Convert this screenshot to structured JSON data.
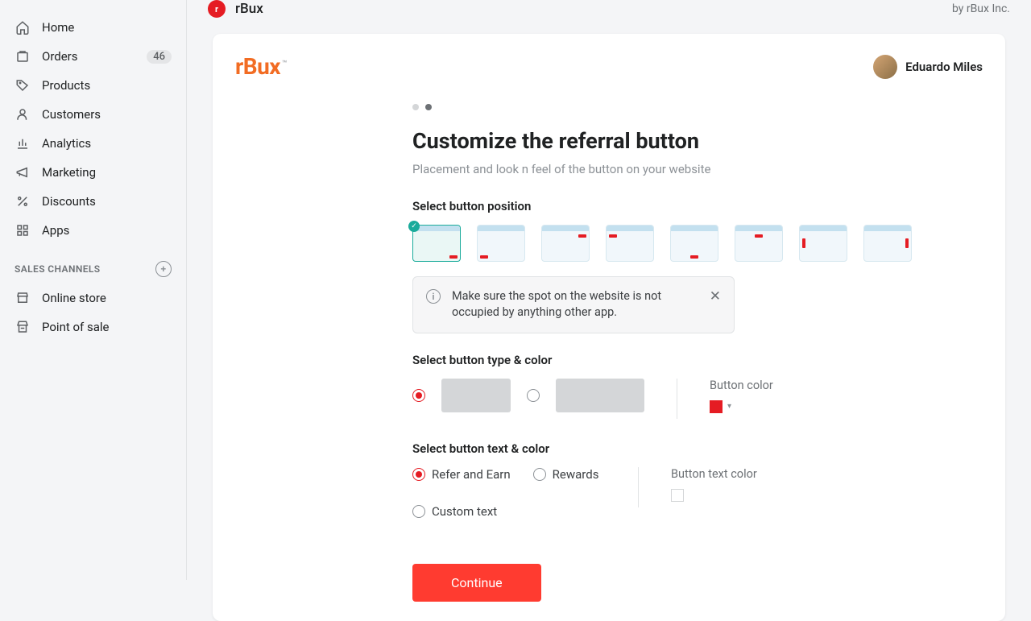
{
  "sidebar": {
    "items": [
      {
        "label": "Home",
        "icon": "home"
      },
      {
        "label": "Orders",
        "icon": "orders",
        "badge": "46"
      },
      {
        "label": "Products",
        "icon": "products"
      },
      {
        "label": "Customers",
        "icon": "customers"
      },
      {
        "label": "Analytics",
        "icon": "analytics"
      },
      {
        "label": "Marketing",
        "icon": "marketing"
      },
      {
        "label": "Discounts",
        "icon": "discounts"
      },
      {
        "label": "Apps",
        "icon": "apps"
      }
    ],
    "channels_header": "SALES CHANNELS",
    "channels": [
      {
        "label": "Online store"
      },
      {
        "label": "Point of sale"
      }
    ]
  },
  "topbar": {
    "app": "rBux",
    "byline": "by rBux Inc."
  },
  "card": {
    "brand": "rBux",
    "user": "Eduardo Miles",
    "title": "Customize the referral button",
    "subtitle": "Placement and look n feel of the button on your website",
    "section_position": "Select button position",
    "tip": "Make sure the spot on the website is not occupied by anything other app.",
    "section_type": "Select button type & color",
    "button_color_label": "Button color",
    "button_color": "#e51c23",
    "section_text": "Select button text & color",
    "text_options": [
      "Refer and Earn",
      "Rewards",
      "Custom text"
    ],
    "text_color_label": "Button text color",
    "continue": "Continue"
  }
}
